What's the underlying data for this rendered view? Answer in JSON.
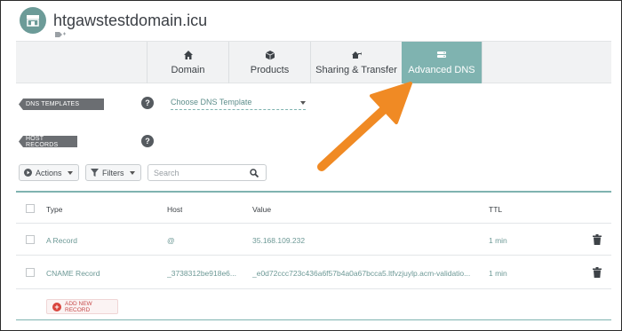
{
  "header": {
    "domain": "htgawstestdomain.icu"
  },
  "tabs": [
    {
      "label": "Domain",
      "icon": "home-icon"
    },
    {
      "label": "Products",
      "icon": "box-icon"
    },
    {
      "label": "Sharing & Transfer",
      "icon": "share-icon"
    },
    {
      "label": "Advanced DNS",
      "icon": "dns-icon"
    }
  ],
  "active_tab": "Advanced DNS",
  "dns_templates": {
    "label": "DNS TEMPLATES",
    "select_value": "Choose DNS Template"
  },
  "host_records": {
    "label": "HOST RECORDS"
  },
  "toolbar": {
    "actions": "Actions",
    "filters": "Filters",
    "search_placeholder": "Search"
  },
  "table": {
    "columns": [
      "Type",
      "Host",
      "Value",
      "TTL"
    ],
    "rows": [
      {
        "type": "A Record",
        "host": "@",
        "value": "35.168.109.232",
        "ttl": "1 min"
      },
      {
        "type": "CNAME Record",
        "host": "_3738312be918e6...",
        "value": "_e0d72ccc723c436a6f57b4a0a67bcca5.ltfvzjuylp.acm-validatio...",
        "ttl": "1 min"
      }
    ]
  },
  "add_record": "ADD NEW RECORD",
  "colors": {
    "accent": "#7fb3b0",
    "arrow": "#f08a24",
    "danger": "#d9453e"
  }
}
